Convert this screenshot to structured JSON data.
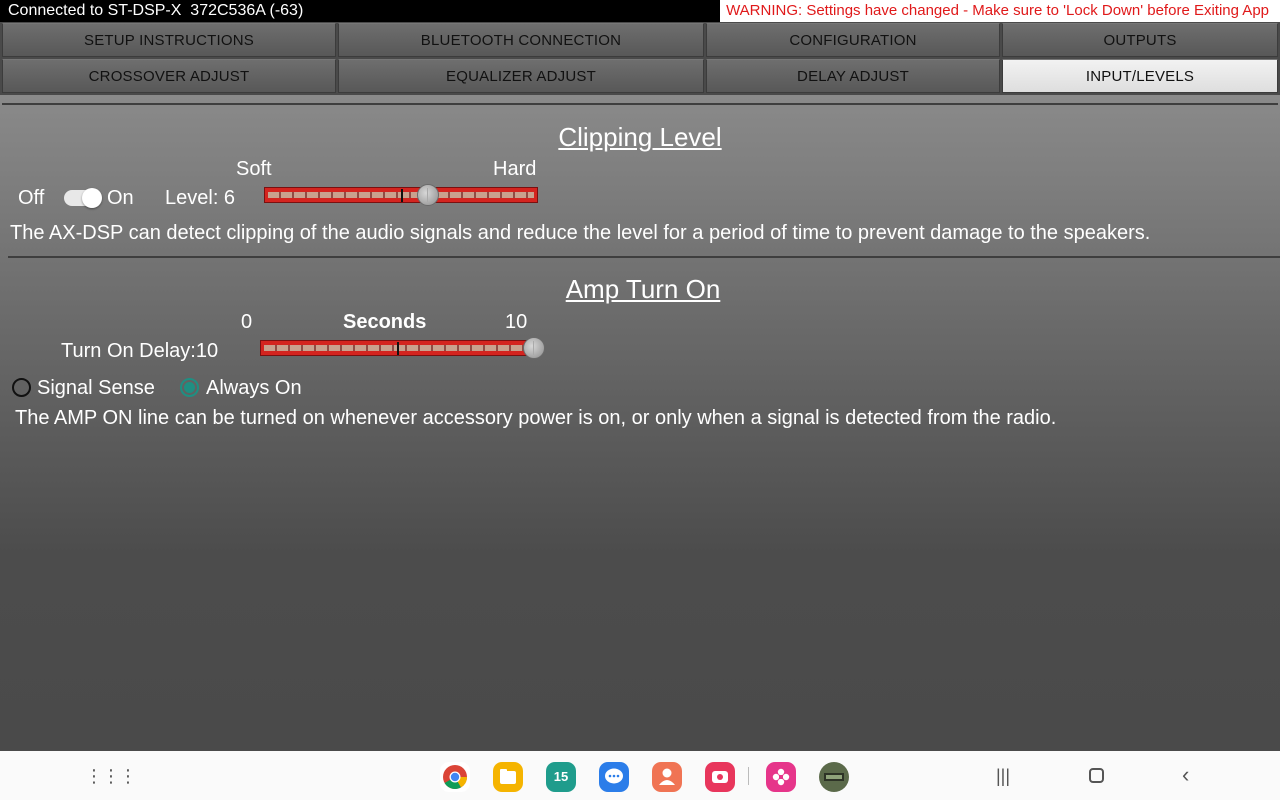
{
  "status_bar": {
    "connection_text": "Connected to ST-DSP-X  372C536A (-63)",
    "warning_text": "WARNING: Settings have changed - Make sure to 'Lock Down' before Exiting App"
  },
  "tabs": [
    {
      "label": "SETUP INSTRUCTIONS",
      "active": false
    },
    {
      "label": "BLUETOOTH CONNECTION",
      "active": false
    },
    {
      "label": "CONFIGURATION",
      "active": false
    },
    {
      "label": "OUTPUTS",
      "active": false
    },
    {
      "label": "CROSSOVER ADJUST",
      "active": false
    },
    {
      "label": "EQUALIZER ADJUST",
      "active": false
    },
    {
      "label": "DELAY ADJUST",
      "active": false
    },
    {
      "label": "INPUT/LEVELS",
      "active": true
    }
  ],
  "clipping": {
    "title": "Clipping Level",
    "soft_label": "Soft",
    "hard_label": "Hard",
    "off_label": "Off",
    "on_label": "On",
    "toggle_on": true,
    "level_text": "Level: 6",
    "level_value": 6,
    "level_fraction": 0.6,
    "description": "The AX-DSP can detect clipping of the audio signals and reduce the level for a period of time to prevent damage to the speakers."
  },
  "amp": {
    "title": "Amp Turn On",
    "min_label": "0",
    "unit_label": "Seconds",
    "max_label": "10",
    "delay_text": "Turn On Delay:10",
    "delay_value": 10,
    "delay_fraction": 1.0,
    "signal_sense_label": "Signal Sense",
    "always_on_label": "Always On",
    "selected_mode": "Always On",
    "description": "The AMP ON line can be turned on whenever accessory power is on, or only when a signal is detected from the radio."
  },
  "navbar": {
    "apps": [
      {
        "name": "chrome-icon",
        "color": "#ffffff"
      },
      {
        "name": "files-icon",
        "color": "#f5b400"
      },
      {
        "name": "calendar-icon",
        "color": "#1f9c8c",
        "text": "15"
      },
      {
        "name": "messages-icon",
        "color": "#2b7de9"
      },
      {
        "name": "contacts-icon",
        "color": "#f07454"
      },
      {
        "name": "screen-recorder-icon",
        "color": "#e8365c"
      },
      {
        "name": "bixby-flower-icon",
        "color": "#e6358a"
      },
      {
        "name": "app-thumbnail-icon",
        "color": "#5b6a4a"
      }
    ]
  }
}
